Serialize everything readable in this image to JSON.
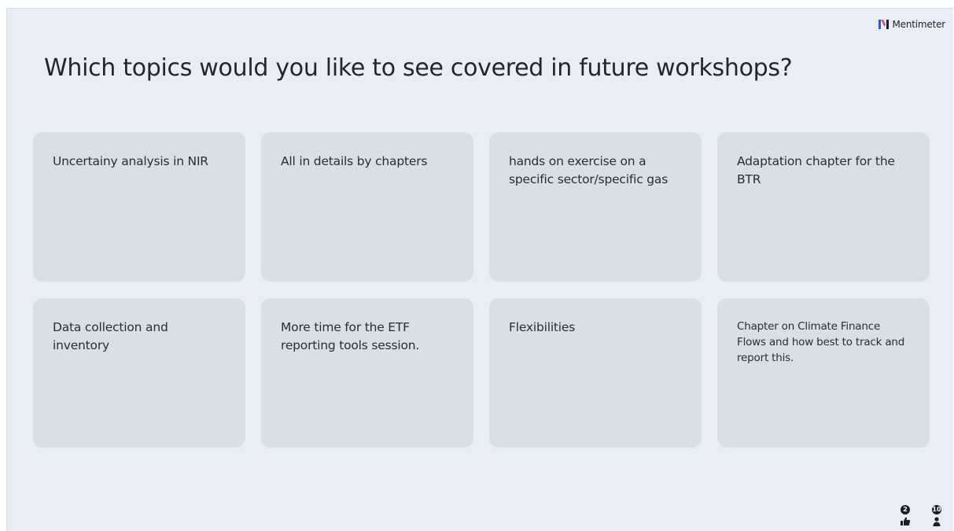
{
  "brand": {
    "name": "Mentimeter",
    "logo_icon": "mentimeter-logo-icon",
    "logo_colors": [
      "#2a5bd7",
      "#e8495b",
      "#1c1e24"
    ]
  },
  "question": "Which topics would you like to see covered in future workshops?",
  "responses": [
    "Uncertainy analysis in NIR",
    "All in details by chapters",
    "hands on exercise on a specific sector/specific gas",
    "Adaptation chapter for the BTR",
    "Data collection and inventory",
    "More time for the ETF reporting tools session.",
    "Flexibilities",
    "Chapter on Climate Finance Flows and how best to track and report this."
  ],
  "reactions": [
    {
      "icon": "thumbs-up-icon",
      "count": "2"
    },
    {
      "icon": "person-icon",
      "count": "10"
    }
  ],
  "colors": {
    "slide_background": "#e9eef6",
    "card_background": "#d8dfe7",
    "text": "#23262f"
  }
}
